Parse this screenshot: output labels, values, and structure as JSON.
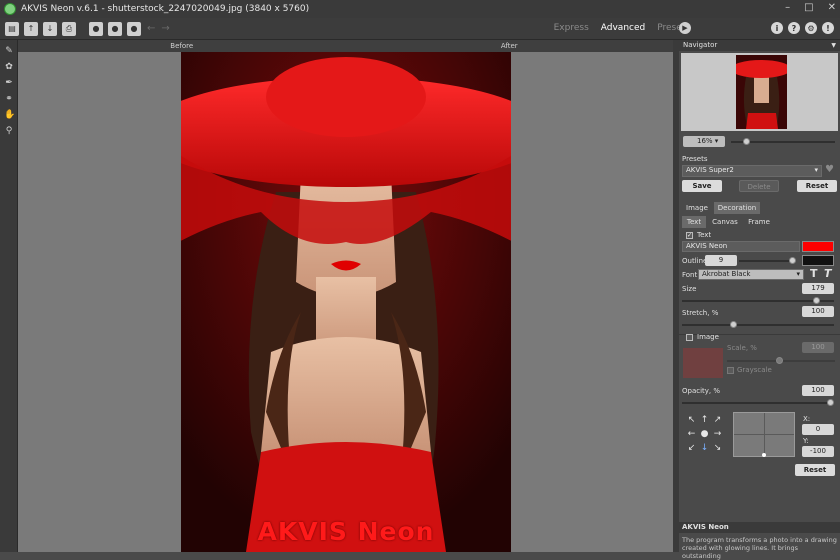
{
  "window": {
    "title": "AKVIS Neon v.6.1 - shutterstock_2247020049.jpg (3840 x 5760)"
  },
  "toolbar": {
    "modes": [
      "Express",
      "Advanced",
      "Presets"
    ],
    "active_mode": "Advanced"
  },
  "canvas": {
    "tab_before": "Before",
    "tab_after": "After",
    "photo_text": "AKVIS Neon"
  },
  "navigator": {
    "title": "Navigator",
    "zoom": "16%",
    "zoom_level": 0.12
  },
  "presets": {
    "label": "Presets",
    "selected": "AKVIS Super2",
    "save_label": "Save",
    "delete_label": "Delete",
    "reset_label": "Reset"
  },
  "settings": {
    "main_tabs": [
      "Image",
      "Decoration"
    ],
    "active_main_tab": "Decoration",
    "sub_tabs": [
      "Text",
      "Canvas",
      "Frame"
    ],
    "active_sub_tab": "Text",
    "text_check_label": "Text",
    "text_value": "AKVIS Neon",
    "text_color": "#ff0000",
    "outline_label": "Outline",
    "outline_value": "9",
    "outline_color": "#111111",
    "font_label": "Font",
    "font_value": "Akrobat Black",
    "bold_glyph": "T",
    "italic_glyph": "T",
    "size_label": "Size",
    "size_value": "179",
    "size_level": 0.9,
    "stretch_label": "Stretch, %",
    "stretch_value": "100",
    "stretch_level": 0.33,
    "image_check_label": "Image",
    "scale_label": "Scale, %",
    "scale_value": "100",
    "grayscale_label": "Grayscale",
    "opacity_label": "Opacity, %",
    "opacity_value": "100",
    "opacity_level": 1.0,
    "x_label": "X:",
    "x_value": "0",
    "y_label": "Y:",
    "y_value": "-100",
    "reset_label": "Reset"
  },
  "description": {
    "title": "AKVIS Neon",
    "text": "The program transforms a photo into a drawing created with glowing lines. It brings outstanding"
  },
  "icons": {
    "app": "akvis-neon-app-icon",
    "play": "play-icon",
    "info": "info-icon",
    "help": "help-icon",
    "settings": "gear-icon",
    "feedback": "message-icon"
  }
}
